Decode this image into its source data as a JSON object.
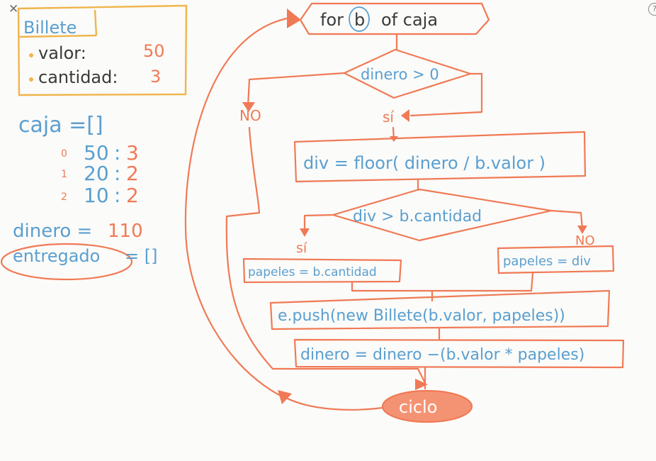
{
  "toolbar": {
    "close_label": "✕",
    "help_label": "?"
  },
  "class_box": {
    "title": "Billete",
    "fields": [
      {
        "name": "valor:",
        "value": "50"
      },
      {
        "name": "cantidad:",
        "value": "3"
      }
    ]
  },
  "caja": {
    "label": "caja =[]",
    "items": [
      {
        "index": "0",
        "valor": "50",
        "cantidad": "3"
      },
      {
        "index": "1",
        "valor": "20",
        "cantidad": "2"
      },
      {
        "index": "2",
        "valor": "10",
        "cantidad": "2"
      }
    ]
  },
  "variables": {
    "dinero_label": "dinero =",
    "dinero_value": "110",
    "entregado_label": "entregado",
    "entregado_value": "= []"
  },
  "flow": {
    "loop_header": {
      "prefix": "for",
      "var": "b",
      "suffix": "of caja"
    },
    "cond1": "dinero > 0",
    "cond1_yes": "sí",
    "cond1_no": "NO",
    "step_div": "div = floor( dinero / b.valor )",
    "cond2": "div > b.cantidad",
    "cond2_yes": "sí",
    "cond2_no": "NO",
    "assign_yes": "papeles = b.cantidad",
    "assign_no": "papeles = div",
    "push": "e.push(new Billete(b.valor, papeles))",
    "update": "dinero = dinero −(b.valor * papeles)",
    "end": "ciclo"
  }
}
